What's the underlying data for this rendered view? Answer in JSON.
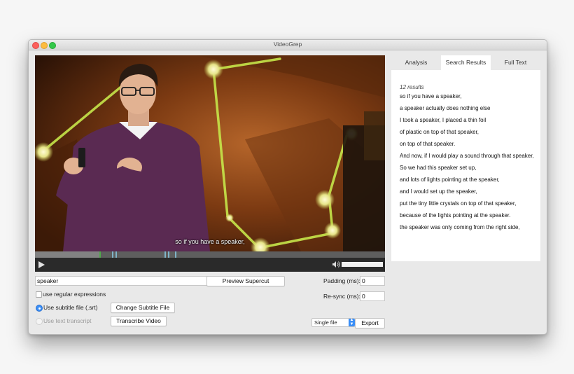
{
  "window": {
    "title": "VideoGrep"
  },
  "video": {
    "subtitle": "so if you have a speaker,"
  },
  "form": {
    "search_value": "speaker",
    "preview_button": "Preview Supercut",
    "regex_label": "use regular expressions",
    "subtitle_label": "Use subtitle file (.srt)",
    "change_subtitle_button": "Change Subtitle File",
    "transcript_label": "Use text transcript",
    "transcribe_button": "Transcribe Video",
    "padding_label": "Padding (ms):",
    "padding_value": "0",
    "resync_label": "Re-sync (ms):",
    "resync_value": "0",
    "output_mode": "Single file",
    "export_button": "Export"
  },
  "tabs": [
    {
      "label": "Analysis"
    },
    {
      "label": "Search Results"
    },
    {
      "label": "Full Text"
    }
  ],
  "active_tab": "Search Results",
  "results": {
    "count": "12 results",
    "items": [
      "so if you have a speaker,",
      "a speaker actually does nothing else",
      "I took a speaker, I placed a thin foil",
      "of plastic on top of that speaker,",
      "on top of that speaker.",
      "And now, if I would play a sound through that speaker,",
      "So we had this speaker set up,",
      "and lots of lights pointing at the speaker,",
      "and I would set up the speaker,",
      "put the tiny little crystals on top of that speaker,",
      "because of the lights pointing at the speaker.",
      "the speaker was only coming from the right side,"
    ]
  },
  "icons": {
    "play": "play-icon",
    "volume": "volume-icon",
    "select_arrows": "updown-chevron-icon"
  },
  "colors": {
    "accent": "#3a8ef6",
    "timeline_marker": "#7fb3c8",
    "timeline_green": "#4fa84a"
  }
}
